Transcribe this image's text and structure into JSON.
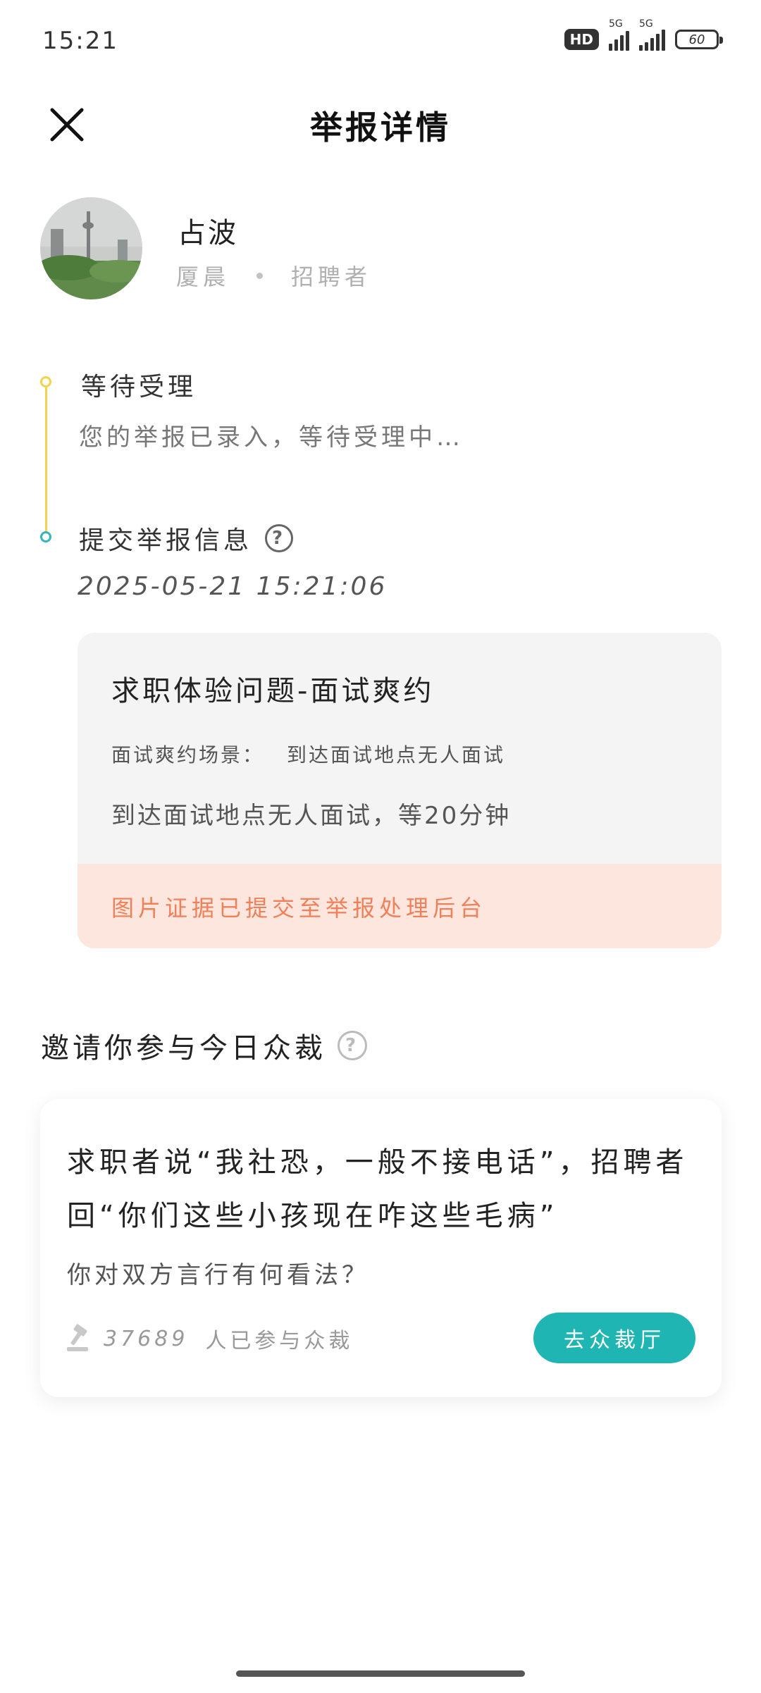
{
  "status_bar": {
    "time": "15:21",
    "hd": "HD",
    "net1": "5G",
    "net2": "5G",
    "battery": "60"
  },
  "header": {
    "title": "举报详情",
    "close_icon": "close-icon"
  },
  "profile": {
    "name": "占波",
    "company": "厦晨",
    "role": "招聘者"
  },
  "timeline": {
    "step1_title": "等待受理",
    "step1_desc": "您的举报已录入，等待受理中…",
    "step2_title": "提交举报信息",
    "step2_time": "2025-05-21 15:21:06",
    "help_glyph": "?"
  },
  "report": {
    "title": "求职体验问题-面试爽约",
    "scene_label": "面试爽约场景：",
    "scene_value": "到达面试地点无人面试",
    "detail": "到达面试地点无人面试，等20分钟",
    "footer": "图片证据已提交至举报处理后台"
  },
  "invite": {
    "title": "邀请你参与今日众裁",
    "help_glyph": "?"
  },
  "jury": {
    "text": "求职者说“我社恐，一般不接电话”，招聘者回“你们这些小孩现在咋这些毛病”",
    "question": "你对双方言行有何看法？",
    "count": "37689",
    "count_suffix": "人已参与众裁",
    "button": "去众裁厅"
  },
  "colors": {
    "teal": "#1fb5b3",
    "yellow": "#f2d24f",
    "orange": "#f0805a",
    "footer_bg": "#fde6dd"
  }
}
